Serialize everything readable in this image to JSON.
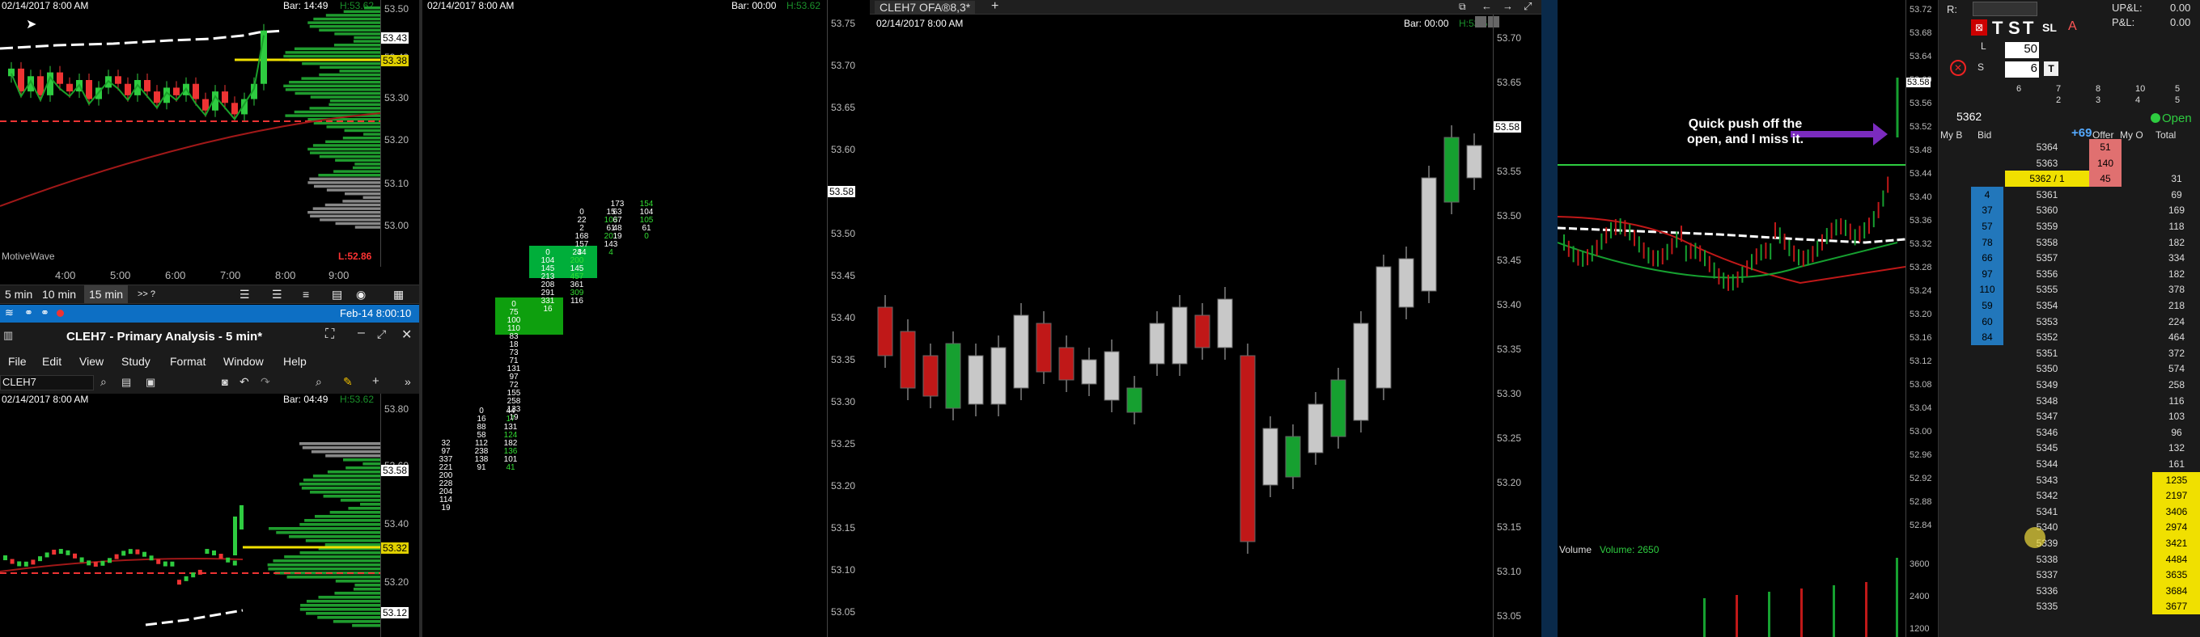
{
  "chart1": {
    "date": "02/14/2017 8:00 AM",
    "bar": "Bar: 14:49",
    "high": "H:53.62",
    "low": "L:52.86",
    "brand": "MotiveWave",
    "time_labels": [
      "4:00",
      "5:00",
      "6:00",
      "7:00",
      "8:00",
      "9:00"
    ],
    "price_labels": [
      "53.50",
      "53.40",
      "53.30",
      "53.20",
      "53.10",
      "53.00"
    ],
    "markers": [
      "53.43",
      "53.38"
    ],
    "candle_closes": [
      53.42,
      53.36,
      53.4,
      53.35,
      53.41,
      53.38,
      53.36,
      53.39,
      53.34,
      53.37,
      53.4,
      53.38,
      53.35,
      53.39,
      53.36,
      53.33,
      53.37,
      53.35,
      53.38,
      53.34,
      53.31,
      53.36,
      53.33,
      53.3,
      53.34,
      53.38,
      53.52
    ]
  },
  "timeframe_bar": {
    "buttons": [
      "5 min",
      "10 min",
      "15 min"
    ],
    "active": "15 min",
    "more": ">> ?"
  },
  "status_bar": {
    "date_time": "Feb-14 8:00:10"
  },
  "chart2_window": {
    "title": "CLEH7 - Primary Analysis - 5 min*",
    "menu": [
      "File",
      "Edit",
      "View",
      "Study",
      "Format",
      "Window",
      "Help"
    ],
    "symbol": "CLEH7",
    "date": "02/14/2017 8:00 AM",
    "bar": "Bar: 04:49",
    "high": "H:53.62",
    "price_labels": [
      "53.80",
      "53.60",
      "53.40",
      "53.20"
    ],
    "markers": [
      "53.58",
      "53.32",
      "53.12"
    ]
  },
  "footprint": {
    "date": "02/14/2017 8:00 AM",
    "bar": "Bar: 00:00",
    "high": "H:53.62",
    "price_labels": [
      "53.75",
      "53.70",
      "53.65",
      "53.60",
      "53.55",
      "53.50",
      "53.45",
      "53.40",
      "53.35",
      "53.30",
      "53.25",
      "53.20",
      "53.15",
      "53.10",
      "53.05"
    ],
    "marker": "53.58",
    "columns": [
      {
        "bid": [
          "32",
          "97",
          "337",
          "221",
          "200",
          "228",
          "204",
          "114",
          "19"
        ],
        "ask": [
          "",
          "",
          "",
          "",
          "",
          "",
          "",
          "",
          ""
        ]
      },
      {
        "bid": [
          "0",
          "16",
          "88",
          "58",
          "112",
          "238",
          "138",
          "91"
        ],
        "ask": [
          "44",
          "17",
          "131",
          "124",
          "182",
          "136",
          "101",
          "41"
        ]
      },
      {
        "bid": [
          "0",
          "75",
          "100",
          "110",
          "83",
          "18",
          "73",
          "71",
          "131",
          "97",
          "72",
          "155",
          "258",
          "133",
          "19"
        ],
        "ask": [
          "",
          "",
          "",
          "",
          "",
          "",
          "",
          "",
          "",
          "",
          "",
          "",
          "",
          "",
          ""
        ]
      },
      {
        "bid": [
          "0",
          "104",
          "145",
          "213",
          "208",
          "291",
          "331",
          "16"
        ],
        "ask": [
          "24",
          "200",
          "145",
          "457",
          "361",
          "309",
          "116",
          ""
        ]
      },
      {
        "bid": [
          "0",
          "22",
          "2",
          "168",
          "157",
          "34"
        ],
        "ask": [
          "15",
          "103",
          "61",
          "201",
          "143",
          "4"
        ]
      },
      {
        "bid": [
          "",
          "173",
          "63",
          "67",
          "48",
          "19"
        ],
        "ask": [
          "",
          "154",
          "104",
          "105",
          "61",
          "0"
        ]
      }
    ]
  },
  "ofa_window": {
    "title": "CLEH7 OFA®8,3*",
    "add_tab": "+",
    "date": "02/14/2017 8:00 AM",
    "bar": "Bar: 00:00",
    "high": "H:53.62",
    "price_labels": [
      "53.70",
      "53.65",
      "53.60",
      "53.55",
      "53.50",
      "53.45",
      "53.40",
      "53.35",
      "53.30",
      "53.25",
      "53.20",
      "53.15",
      "53.10",
      "53.05"
    ],
    "marker": "53.58"
  },
  "chart4": {
    "annotation": "Quick push off the open, and I miss it.",
    "volume_label": "Volume",
    "volume_value": "Volume: 2650",
    "price_labels": [
      "53.72",
      "53.68",
      "53.64",
      "53.60",
      "53.56",
      "53.52",
      "53.48",
      "53.44",
      "53.40",
      "53.36",
      "53.32",
      "53.28",
      "53.24",
      "53.20",
      "53.16",
      "53.12",
      "53.08",
      "53.04",
      "53.00",
      "52.96",
      "52.92",
      "52.88",
      "52.84"
    ],
    "volume_labels": [
      "3600",
      "2400",
      "1200"
    ],
    "marker": "53.58"
  },
  "dom": {
    "r_label": "R:",
    "up_l": "UP&L:",
    "up_l_value": "0.00",
    "pl": "P&L:",
    "pl_value": "0.00",
    "l_label": "L",
    "l_value": "50",
    "s_label": "S",
    "s_value": "6",
    "size_cols": [
      "6",
      "7",
      "8",
      "10",
      "5"
    ],
    "size_cols2": [
      "2",
      "3",
      "4",
      "5"
    ],
    "price_box": "5362",
    "status": "Open",
    "net": "+69",
    "headers": [
      "My B",
      "Bid",
      "",
      "Offer",
      "My O",
      "Total"
    ],
    "rows": [
      {
        "price": "5364",
        "bid": "",
        "offer": "51",
        "total": ""
      },
      {
        "price": "5363",
        "bid": "",
        "offer": "140",
        "total": ""
      },
      {
        "price": "5362 / 1",
        "bid": "",
        "offer": "45",
        "total": "31"
      },
      {
        "price": "5361",
        "bid": "4",
        "offer": "",
        "total": "69"
      },
      {
        "price": "5360",
        "bid": "37",
        "offer": "",
        "total": "169"
      },
      {
        "price": "5359",
        "bid": "57",
        "offer": "",
        "total": "118"
      },
      {
        "price": "5358",
        "bid": "78",
        "offer": "",
        "total": "182"
      },
      {
        "price": "5357",
        "bid": "66",
        "offer": "",
        "total": "334"
      },
      {
        "price": "5356",
        "bid": "97",
        "offer": "",
        "total": "182"
      },
      {
        "price": "5355",
        "bid": "110",
        "offer": "",
        "total": "378"
      },
      {
        "price": "5354",
        "bid": "59",
        "offer": "",
        "total": "218"
      },
      {
        "price": "5353",
        "bid": "60",
        "offer": "",
        "total": "224"
      },
      {
        "price": "5352",
        "bid": "84",
        "offer": "",
        "total": "464"
      },
      {
        "price": "5351",
        "bid": "",
        "offer": "",
        "total": "372"
      },
      {
        "price": "5350",
        "bid": "",
        "offer": "",
        "total": "574"
      },
      {
        "price": "5349",
        "bid": "",
        "offer": "",
        "total": "258"
      },
      {
        "price": "5348",
        "bid": "",
        "offer": "",
        "total": "116"
      },
      {
        "price": "5347",
        "bid": "",
        "offer": "",
        "total": "103"
      },
      {
        "price": "5346",
        "bid": "",
        "offer": "",
        "total": "96"
      },
      {
        "price": "5345",
        "bid": "",
        "offer": "",
        "total": "132"
      },
      {
        "price": "5344",
        "bid": "",
        "offer": "",
        "total": "161"
      },
      {
        "price": "5343",
        "bid": "",
        "offer": "",
        "total": "1235"
      },
      {
        "price": "5342",
        "bid": "",
        "offer": "",
        "total": "2197"
      },
      {
        "price": "5341",
        "bid": "",
        "offer": "",
        "total": "3406"
      },
      {
        "price": "5340",
        "bid": "",
        "offer": "",
        "total": "2974"
      },
      {
        "price": "5339",
        "bid": "",
        "offer": "",
        "total": "3421"
      },
      {
        "price": "5338",
        "bid": "",
        "offer": "",
        "total": "4484"
      },
      {
        "price": "5337",
        "bid": "",
        "offer": "",
        "total": "3635"
      },
      {
        "price": "5336",
        "bid": "",
        "offer": "",
        "total": "3684"
      },
      {
        "price": "5335",
        "bid": "",
        "offer": "",
        "total": "3677"
      }
    ]
  }
}
